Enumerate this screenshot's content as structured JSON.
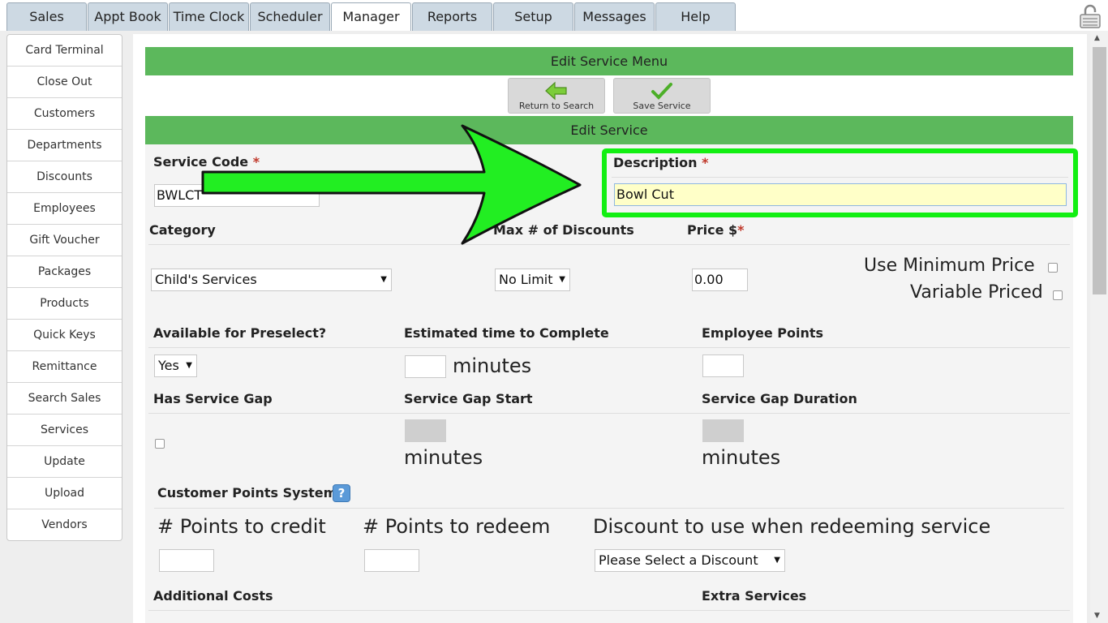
{
  "tabs": [
    {
      "label": "Sales"
    },
    {
      "label": "Appt Book"
    },
    {
      "label": "Time Clock"
    },
    {
      "label": "Scheduler"
    },
    {
      "label": "Manager"
    },
    {
      "label": "Reports"
    },
    {
      "label": "Setup"
    },
    {
      "label": "Messages"
    },
    {
      "label": "Help"
    }
  ],
  "active_tab": "Manager",
  "sidebar": {
    "items": [
      {
        "label": "Card Terminal"
      },
      {
        "label": "Close Out"
      },
      {
        "label": "Customers"
      },
      {
        "label": "Departments"
      },
      {
        "label": "Discounts"
      },
      {
        "label": "Employees"
      },
      {
        "label": "Gift Voucher"
      },
      {
        "label": "Packages"
      },
      {
        "label": "Products"
      },
      {
        "label": "Quick Keys"
      },
      {
        "label": "Remittance"
      },
      {
        "label": "Search Sales"
      },
      {
        "label": "Services"
      },
      {
        "label": "Update"
      },
      {
        "label": "Upload"
      },
      {
        "label": "Vendors"
      }
    ]
  },
  "header": {
    "menu_title": "Edit Service Menu",
    "return_label": "Return to Search",
    "save_label": "Save Service",
    "section_title": "Edit Service"
  },
  "form": {
    "service_code": {
      "label": "Service Code",
      "required_mark": "*",
      "value": "BWLCT"
    },
    "description": {
      "label": "Description",
      "required_mark": "*",
      "value": "Bowl Cut"
    },
    "category": {
      "label": "Category",
      "value": "Child's Services"
    },
    "max_discounts": {
      "label": "Max # of Discounts",
      "value": "No Limit"
    },
    "price": {
      "label": "Price $",
      "required_mark": "*",
      "value": "0.00"
    },
    "use_min_price": {
      "label": "Use Minimum Price",
      "checked": false
    },
    "variable_priced": {
      "label": "Variable Priced",
      "checked": false
    },
    "preselect": {
      "label": "Available for Preselect?",
      "value": "Yes"
    },
    "est_time": {
      "label": "Estimated time to Complete",
      "value": "",
      "unit": "minutes"
    },
    "employee_points": {
      "label": "Employee Points",
      "value": ""
    },
    "has_gap": {
      "label": "Has Service Gap",
      "checked": false
    },
    "gap_start": {
      "label": "Service Gap Start",
      "unit": "minutes"
    },
    "gap_duration": {
      "label": "Service Gap Duration",
      "unit": "minutes"
    },
    "points_system": {
      "label": "Customer Points System",
      "help": "?"
    },
    "points_credit": {
      "label": "# Points to credit",
      "value": ""
    },
    "points_redeem": {
      "label": "# Points to redeem",
      "value": ""
    },
    "redeem_discount": {
      "label": "Discount to use when redeeming service",
      "value": "Please Select a Discount"
    },
    "additional_costs": {
      "label": "Additional Costs"
    },
    "extra_services": {
      "label": "Extra Services"
    }
  },
  "colors": {
    "accent_green": "#5cb85c",
    "highlight": "#12ef12",
    "tab_bg": "#cdd9e3"
  }
}
